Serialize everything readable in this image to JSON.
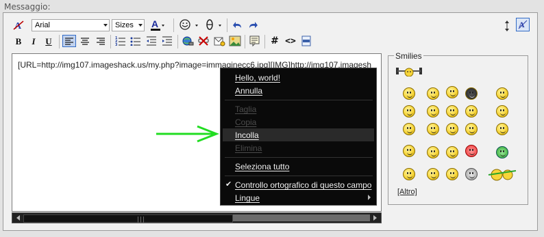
{
  "label": "Messaggio:",
  "toolbar": {
    "font_family": "Arial",
    "font_size": "Sizes",
    "buttons": [
      {
        "name": "remove-format-icon",
        "label": ""
      },
      {
        "name": "bold-button",
        "label": "B"
      },
      {
        "name": "italic-button",
        "label": "I"
      },
      {
        "name": "underline-button",
        "label": "U"
      }
    ]
  },
  "editor": {
    "content": "[URL=http://img107.imageshack.us/my.php?image=immaginecc6.jpg][IMG]http://img107.imagesh"
  },
  "smilies": {
    "title": "Smilies",
    "more_label": "[Altro]"
  },
  "context_menu": {
    "items": [
      {
        "label": "Hello, world!",
        "enabled": true
      },
      {
        "label": "Annulla",
        "enabled": true
      },
      {
        "label": "Taglia",
        "enabled": false
      },
      {
        "label": "Copia",
        "enabled": false
      },
      {
        "label": "Incolla",
        "enabled": true,
        "highlighted": true
      },
      {
        "label": "Elimina",
        "enabled": false
      },
      {
        "label": "Seleziona tutto",
        "enabled": true
      },
      {
        "label": "Controllo ortografico di questo campo",
        "enabled": true,
        "checked": true
      },
      {
        "label": "Lingue",
        "enabled": true,
        "submenu": true
      }
    ]
  },
  "colors": {
    "accent": "#316ac5",
    "arrow": "#22dd22",
    "menu_bg": "#0a0a0a"
  }
}
